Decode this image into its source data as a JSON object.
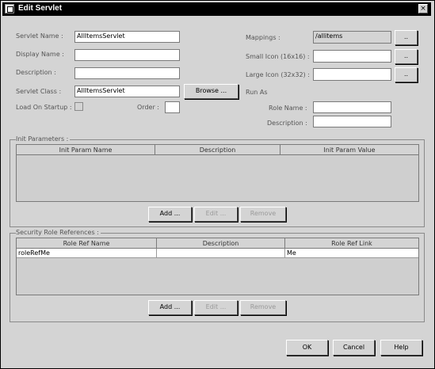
{
  "window": {
    "title": "Edit Servlet",
    "close_glyph": "×",
    "icon": "window-icon"
  },
  "form": {
    "servlet_name_label": "Servlet Name :",
    "servlet_name_value": "AllItemsServlet",
    "display_name_label": "Display Name :",
    "display_name_value": "",
    "description_label": "Description :",
    "description_value": "",
    "servlet_class_label": "Servlet Class :",
    "servlet_class_value": "AllItemsServlet",
    "browse_label": "Browse ...",
    "load_on_startup_label": "Load On Startup :",
    "order_label": "Order :",
    "order_value": "",
    "mappings_label": "Mappings :",
    "mappings_value": "/allitems",
    "small_icon_label": "Small Icon (16x16) :",
    "small_icon_value": "",
    "large_icon_label": "Large Icon (32x32) :",
    "large_icon_value": "",
    "ellipsis": "..",
    "run_as_label": "Run As",
    "role_name_label": "Role Name :",
    "role_name_value": "",
    "run_as_description_label": "Description :",
    "run_as_description_value": ""
  },
  "init_params": {
    "title": "Init Parameters :",
    "columns": [
      "Init Param Name",
      "Description",
      "Init Param Value"
    ],
    "rows": [],
    "add_label": "Add ...",
    "edit_label": "Edit ...",
    "remove_label": "Remove"
  },
  "security_roles": {
    "title": "Security Role References :",
    "columns": [
      "Role Ref Name",
      "Description",
      "Role Ref Link"
    ],
    "rows": [
      {
        "name": "roleRefMe",
        "description": "",
        "link": "Me"
      }
    ],
    "add_label": "Add ...",
    "edit_label": "Edit ...",
    "remove_label": "Remove"
  },
  "footer": {
    "ok_label": "OK",
    "cancel_label": "Cancel",
    "help_label": "Help"
  }
}
